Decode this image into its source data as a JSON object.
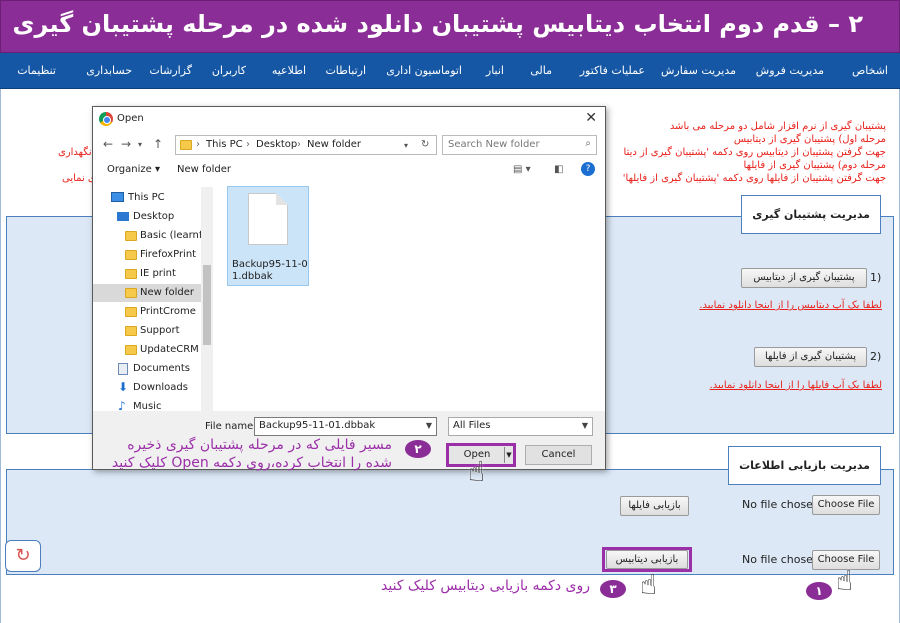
{
  "banner": {
    "title": "۲ – قدم دوم انتخاب دیتابیس پشتیبان دانلود شده در مرحله پشتیبان گیری"
  },
  "nav": {
    "items": [
      "اشخاص",
      "مدیریت فروش",
      "مدیریت سفارش",
      "عملیات فاکتور",
      "مالی",
      "انبار",
      "اتوماسیون اداری",
      "ارتباطات",
      "اطلاعیه",
      "کاربران",
      "گزارشات",
      "حسابداری",
      "تنظیمات"
    ]
  },
  "intro": {
    "lines": [
      "پشتیبان گیری از نرم افزار شامل دو مرحله می باشد",
      "مرحله اول) پشتیبان گیری از دیتابیس",
      "جهت گرفتن پشتیبان از دیتابیس روی دکمه 'پشتیبان گیری از دیتا",
      "مرحله دوم) پشتیبان گیری از فایلها",
      "جهت گرفتن پشتیبان از فایلها روی دکمه 'پشتیبان گیری از فایلها'"
    ],
    "left_fragments": [
      "نگهداری",
      "ی نمایی"
    ]
  },
  "backup_panel": {
    "title": "مدیریت پشتیبان گیری",
    "db_button": "پشتیبان گیری از دیتابیس",
    "db_link": "لطفا یک آپ دیتابیس را از اینجا دانلود نمایید.",
    "files_button": "پشتیبان گیری از فایلها",
    "files_link": "لطفا یک آپ فایلها را از اینجا دانلود نمایید.",
    "num1": "1)",
    "num2": "2)"
  },
  "restore_panel": {
    "title": "مدیریت بازیابی اطلاعات",
    "choose_file_label": "Choose File",
    "no_file_text": "No file chosen",
    "restore_files_button": "بازیابی فایلها",
    "restore_db_button": "بازیابی دیتابیس"
  },
  "dialog": {
    "title": "Open",
    "breadcrumb": [
      "This PC",
      "Desktop",
      "New folder"
    ],
    "search_placeholder": "Search New folder",
    "toolbar": {
      "organize": "Organize",
      "new_folder": "New folder"
    },
    "tree": [
      "This PC",
      "Desktop",
      "Basic (learnfiles",
      "FirefoxPrint",
      "IE print",
      "New folder",
      "PrintCrome",
      "Support",
      "UpdateCRM",
      "Documents",
      "Downloads",
      "Music"
    ],
    "file": {
      "name": "Backup95-11-01.dbbak"
    },
    "file_name_label": "File name:",
    "file_name_value": "Backup95-11-01.dbbak",
    "filter": "All Files",
    "open_label": "Open",
    "cancel_label": "Cancel"
  },
  "annotations": {
    "step2_line1": "مسیر فایلی که در مرحله پشتیبان گیری ذخیره",
    "step2_line2": "شده را انتخاب کرده،روی دکمه Open کلیک کنید",
    "step3": "روی دکمه بازیابی دیتابیس کلیک کنید",
    "badge1": "۱",
    "badge2": "۲",
    "badge3": "۳"
  },
  "colors": {
    "banner": "#8a2d96",
    "nav": "#1557a5",
    "panel": "#dce8f6",
    "accent": "#9b2fa8",
    "red": "#e8201a"
  }
}
